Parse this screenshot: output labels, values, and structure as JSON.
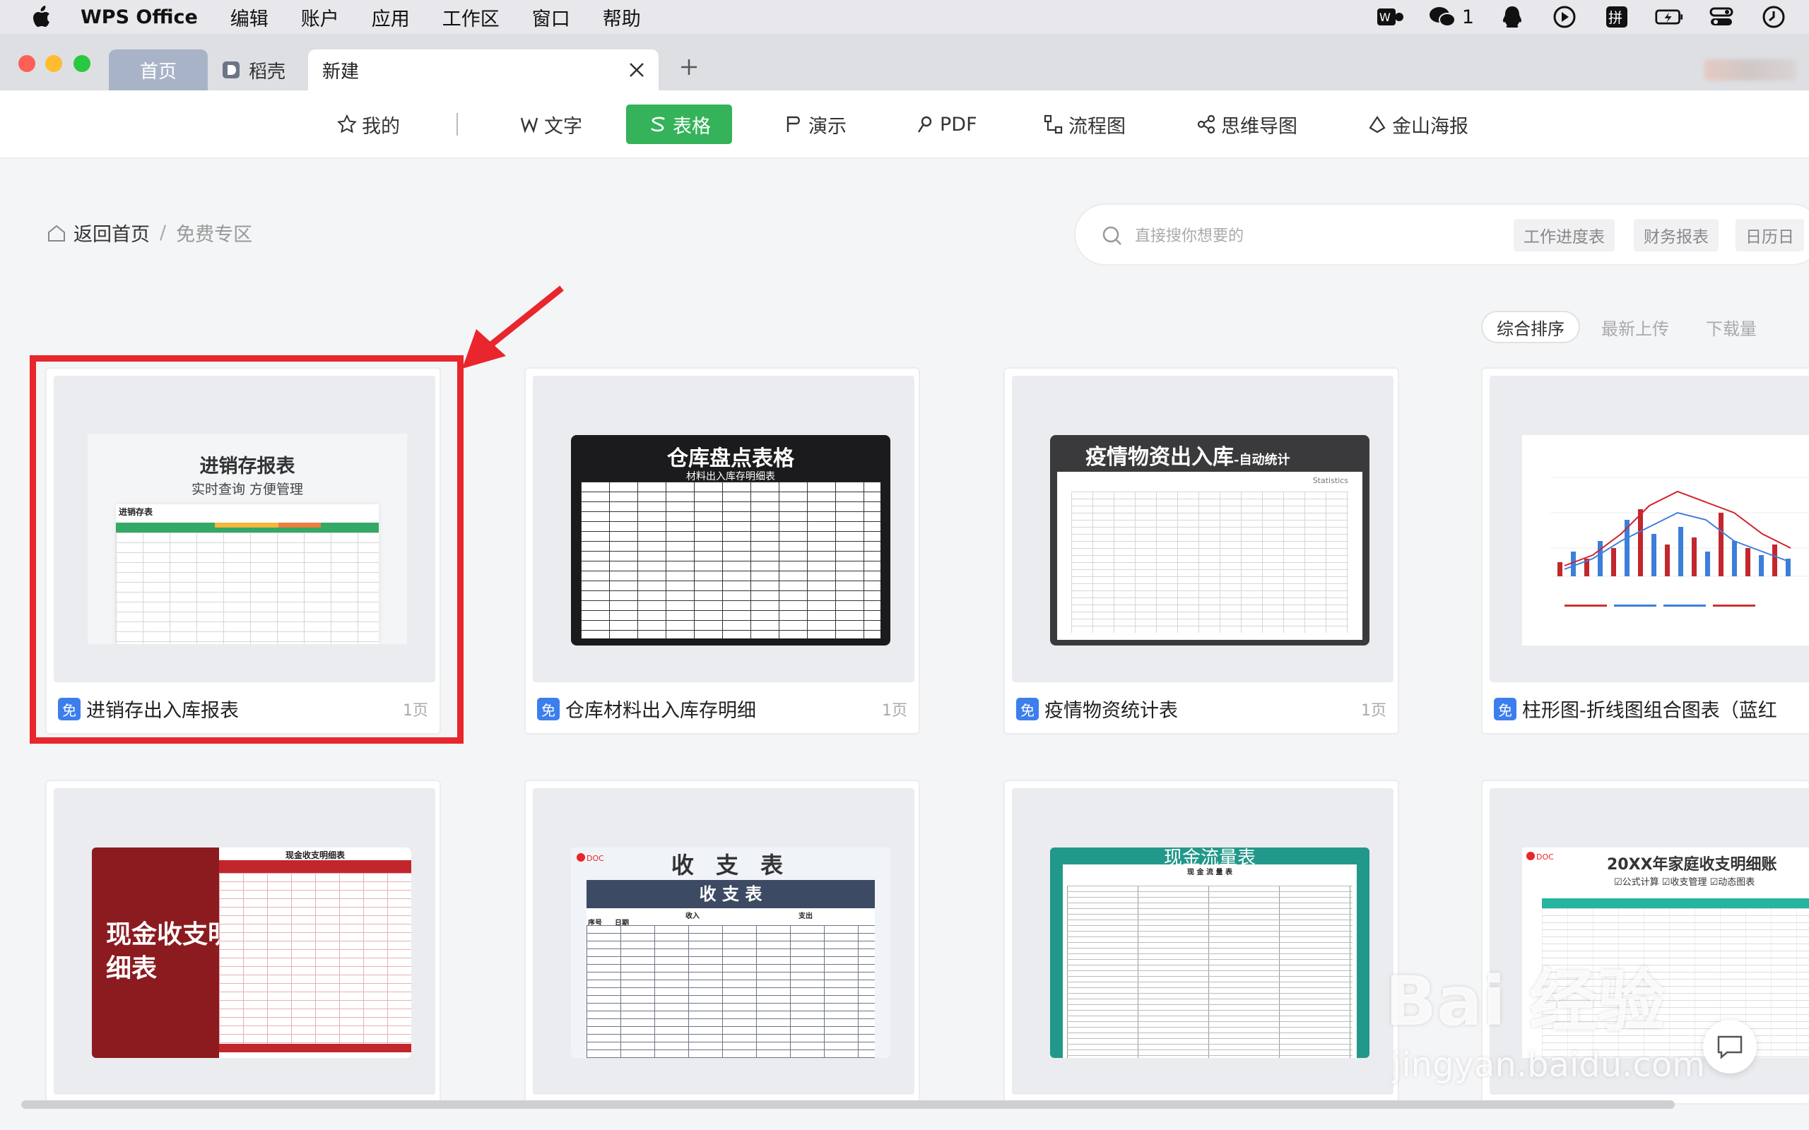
{
  "menubar": {
    "app_name": "WPS Office",
    "items": [
      "编辑",
      "账户",
      "应用",
      "工作区",
      "窗口",
      "帮助"
    ],
    "wechat_count": "1"
  },
  "tabs": {
    "home": "首页",
    "daoke": "稻壳",
    "new": "新建"
  },
  "categories": {
    "mine": "我的",
    "writer": "文字",
    "sheet": "表格",
    "present": "演示",
    "pdf": "PDF",
    "flowchart": "流程图",
    "mindmap": "思维导图",
    "poster": "金山海报"
  },
  "breadcrumb": {
    "home": "返回首页",
    "sep": "/",
    "current": "免费专区"
  },
  "search": {
    "placeholder": "直接搜你想要的",
    "chips": [
      "工作进度表",
      "财务报表",
      "日历日"
    ]
  },
  "sort": {
    "overall": "综合排序",
    "newest": "最新上传",
    "downloads": "下载量"
  },
  "free_badge": "免",
  "cards": [
    {
      "name": "进销存出入库报表",
      "pages": "1页",
      "preview_title": "进销存报表",
      "preview_subtitle": "实时查询 方便管理",
      "sheet_title": "进销存表"
    },
    {
      "name": "仓库材料出入库存明细",
      "pages": "1页",
      "preview_title": "仓库盘点表格",
      "preview_subtitle": "材料出入库存明细表"
    },
    {
      "name": "疫情物资统计表",
      "pages": "1页",
      "preview_title": "疫情物资出入库",
      "preview_suffix": "-自动统计",
      "preview_tag": "Statistics"
    },
    {
      "name": "柱形图-折线图组合图表（蓝红",
      "pages": ""
    }
  ],
  "cards_row2": [
    {
      "preview_title": "现金收支明细表",
      "sheet_title": "现金收支明细表"
    },
    {
      "preview_title": "收 支 表",
      "sheet_title": "收 支 表",
      "col_labels": [
        "序号",
        "日期",
        "收入",
        "支出"
      ]
    },
    {
      "preview_title": "现金流量表",
      "sheet_title": "现 金 流 量 表"
    },
    {
      "preview_title": "20XX年家庭收支明细账",
      "preview_subtitle": "☑公式计算  ☑收支管理  ☑动态图表"
    }
  ],
  "watermark": {
    "brand": "Bai 经验",
    "url": "jingyan.baidu.com"
  },
  "colors": {
    "accent_green": "#35b35a",
    "highlight_red": "#e8262b",
    "free_blue": "#3d7eed"
  }
}
